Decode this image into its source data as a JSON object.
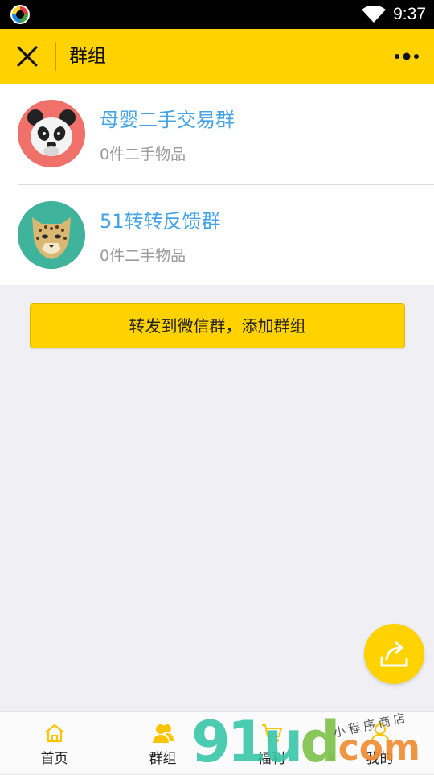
{
  "status_bar": {
    "time": "9:37"
  },
  "header": {
    "title": "群组"
  },
  "groups": [
    {
      "name": "母婴二手交易群",
      "count": "0件二手物品",
      "avatar": "panda-icon",
      "avatar_bg": "#f0716a"
    },
    {
      "name": "51转转反馈群",
      "count": "0件二手物品",
      "avatar": "leopard-icon",
      "avatar_bg": "#3fb39b"
    }
  ],
  "forward_button": {
    "label": "转发到微信群，添加群组"
  },
  "bottom_nav": {
    "items": [
      {
        "label": "首页",
        "icon": "home-icon"
      },
      {
        "label": "群组",
        "icon": "group-icon"
      },
      {
        "label": "福利",
        "icon": "cart-icon"
      },
      {
        "label": "我的",
        "icon": "user-icon"
      }
    ]
  },
  "watermark": {
    "text_num": "91u",
    "text_d": "d",
    "text_com_dot": ".",
    "text_com": "com",
    "text_sub": "小程序商店"
  },
  "colors": {
    "accent": "#ffd200",
    "link": "#45a4e5",
    "muted": "#9a9a9a"
  }
}
